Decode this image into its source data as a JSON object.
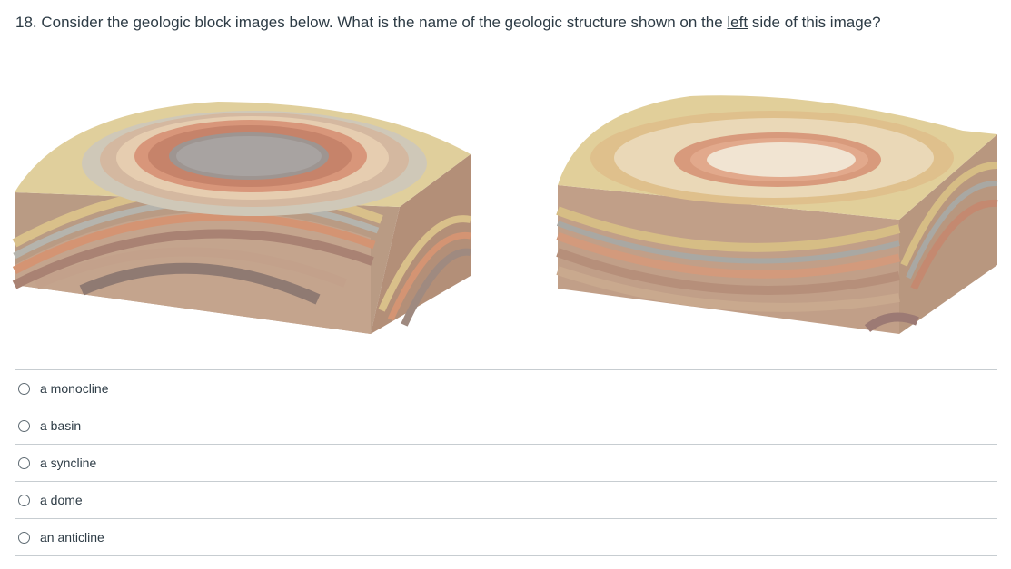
{
  "question": {
    "before": "18. Consider the geologic block images below. What is the name of the geologic structure shown on the ",
    "underlined": "left",
    "after": " side of this image?"
  },
  "figure": {
    "left_block": "dome-block-diagram",
    "right_block": "basin-block-diagram"
  },
  "answers": [
    {
      "label": "a monocline",
      "selected": false
    },
    {
      "label": "a basin",
      "selected": false
    },
    {
      "label": "a syncline",
      "selected": false
    },
    {
      "label": "a dome",
      "selected": false
    },
    {
      "label": "an anticline",
      "selected": false
    }
  ],
  "colors": {
    "text": "#2d3b45",
    "divider": "#c7cdd1",
    "radio_border": "#5f6b73"
  }
}
